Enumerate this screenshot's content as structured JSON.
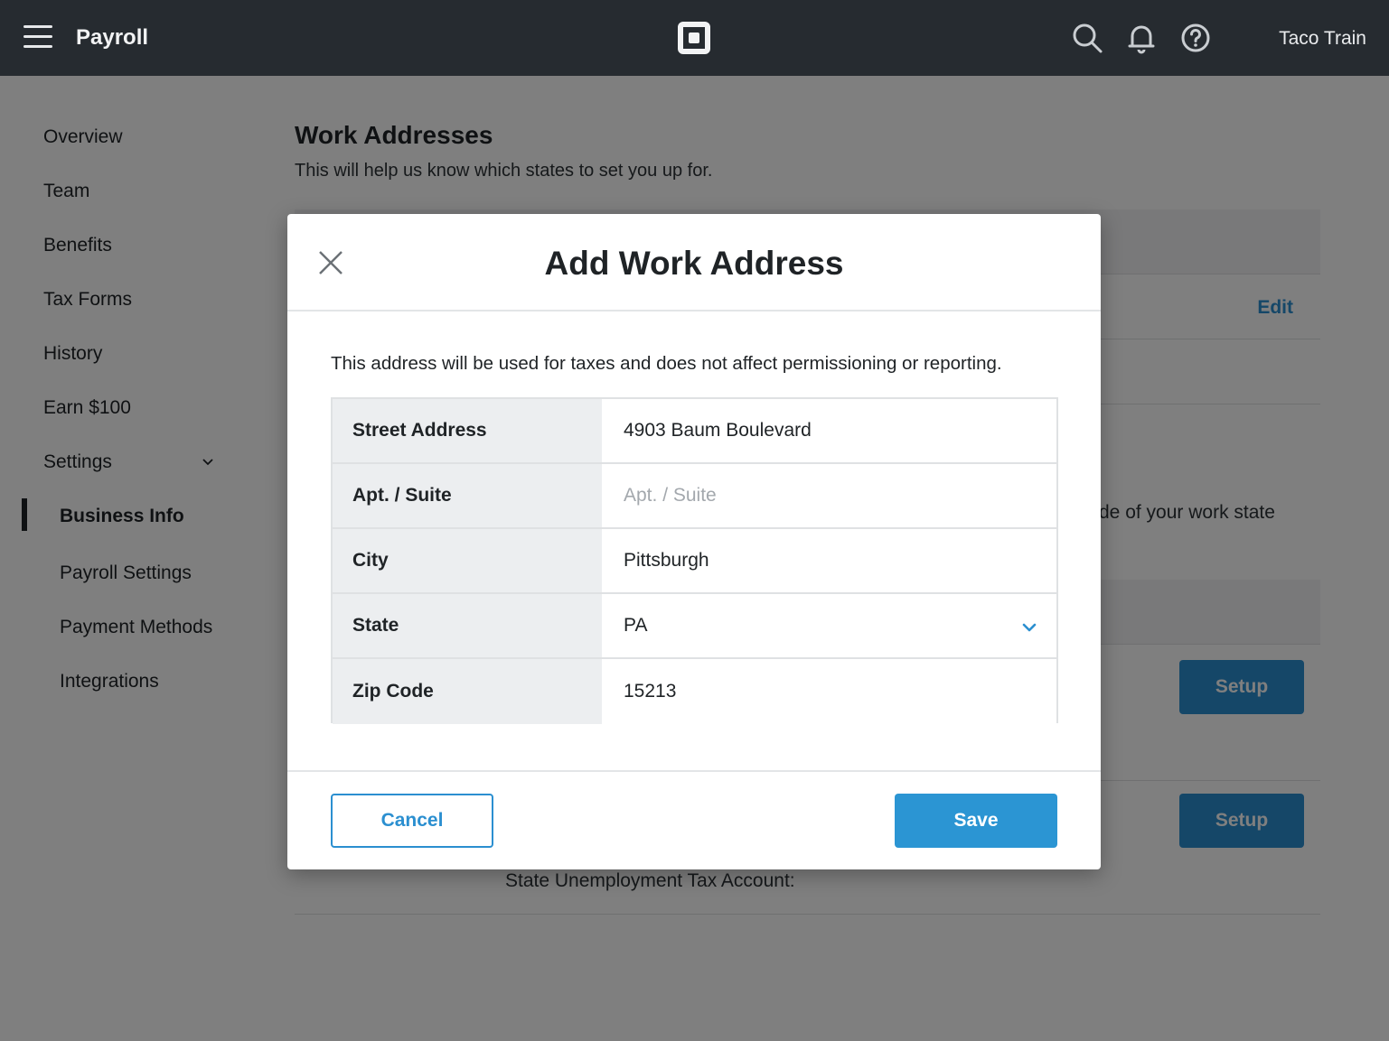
{
  "topbar": {
    "title": "Payroll",
    "account_name": "Taco Train",
    "icons": [
      "menu-icon",
      "square-logo-icon",
      "search-icon",
      "bell-icon",
      "help-icon"
    ]
  },
  "sidebar": {
    "items": [
      {
        "label": "Overview"
      },
      {
        "label": "Team"
      },
      {
        "label": "Benefits"
      },
      {
        "label": "Tax Forms"
      },
      {
        "label": "History"
      },
      {
        "label": "Earn $100"
      },
      {
        "label": "Settings"
      }
    ],
    "settings_items": [
      {
        "label": "Business Info",
        "active": true
      },
      {
        "label": "Payroll Settings"
      },
      {
        "label": "Payment Methods"
      },
      {
        "label": "Integrations"
      }
    ]
  },
  "main": {
    "title": "Work Addresses",
    "subtitle": "This will help us know which states to set you up for.",
    "edit_label": "Edit",
    "partial_text": "de of your work state",
    "setup_label": "Setup",
    "state_unemployment_label": "State Unemployment Tax Account:"
  },
  "modal": {
    "title": "Add Work Address",
    "description": "This address will be used for taxes and does not affect permissioning or reporting.",
    "fields": {
      "street": {
        "label": "Street Address",
        "value": "4903 Baum Boulevard"
      },
      "apt": {
        "label": "Apt. / Suite",
        "value": "",
        "placeholder": "Apt. / Suite"
      },
      "city": {
        "label": "City",
        "value": "Pittsburgh"
      },
      "state": {
        "label": "State",
        "value": "PA"
      },
      "zip": {
        "label": "Zip Code",
        "value": "15213"
      }
    },
    "cancel_label": "Cancel",
    "save_label": "Save"
  },
  "colors": {
    "topbar": "#262b30",
    "accent": "#2b8fd0",
    "label_bg": "#eceef0",
    "overlay": "rgba(0,0,0,0.5)"
  }
}
